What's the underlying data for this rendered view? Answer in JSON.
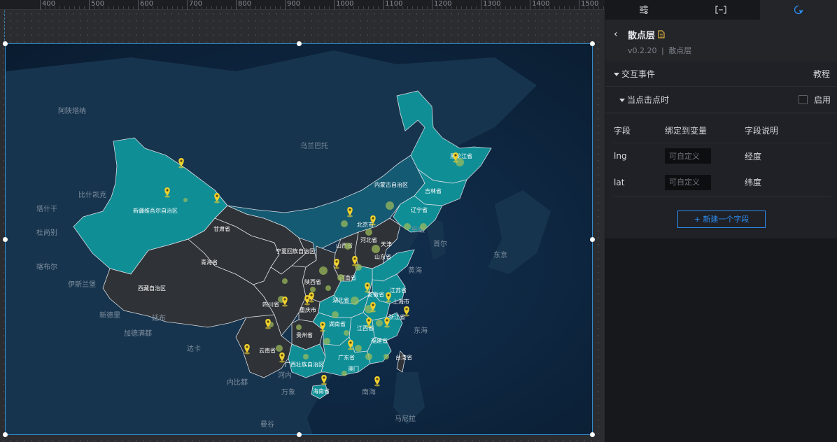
{
  "ruler": {
    "labels": [
      "400",
      "500",
      "600",
      "700",
      "800",
      "900",
      "1000",
      "1100",
      "1200",
      "1300",
      "1400",
      "1500"
    ]
  },
  "map": {
    "province_labels": [
      "新疆维吾尔自治区",
      "西藏自治区",
      "青海省",
      "甘肃省",
      "内蒙古自治区",
      "黑龙江省",
      "吉林省",
      "辽宁省",
      "北京市",
      "天津",
      "河北省",
      "山西省",
      "山东省",
      "宁夏回族自治区",
      "陕西省",
      "河南省",
      "江苏省",
      "上海市",
      "安徽省",
      "湖北省",
      "四川省",
      "重庆市",
      "湖南省",
      "江西省",
      "浙江省",
      "贵州省",
      "云南省",
      "广西壮族自治区",
      "广东省",
      "福建省",
      "台湾省",
      "海南省",
      "澳门"
    ],
    "country_labels": [
      "阿陕塔纳",
      "乌兰巴托",
      "比什凯克",
      "塔什干",
      "杜尚别",
      "喀布尔",
      "伊斯兰堡",
      "新德里",
      "加德满都",
      "廷布",
      "达卡",
      "内比都",
      "河内",
      "万象",
      "曼谷",
      "平壤",
      "首尔",
      "东京",
      "马尼拉",
      "黄海",
      "东海",
      "南海"
    ],
    "colors": {
      "ocean": "#0c2138",
      "land": "#15314a",
      "province_dark": "#2f3337",
      "province_mid": "#155a73",
      "province_teal": "#0f8e96",
      "border": "#d9dde2",
      "pin": "#f2d22e",
      "dot": "#9fbf5a"
    }
  },
  "panel": {
    "tabs": [
      {
        "icon": "sliders-icon",
        "active": false
      },
      {
        "icon": "bracket-icon",
        "active": false
      },
      {
        "icon": "interaction-icon",
        "active": true
      }
    ],
    "title": "散点层",
    "version": "v0.2.20",
    "version_separator": "|",
    "version_subtitle": "散点层",
    "events_section": "交互事件",
    "tutorial_link": "教程",
    "click_section": "当点击点时",
    "enable_label": "启用",
    "table_headers": [
      "字段",
      "绑定到变量",
      "字段说明"
    ],
    "fields": [
      {
        "name": "lng",
        "placeholder": "可自定义",
        "desc": "经度"
      },
      {
        "name": "lat",
        "placeholder": "可自定义",
        "desc": "纬度"
      }
    ],
    "add_field_button": "+ 新建一个字段",
    "accent": "#2d8cf0"
  }
}
